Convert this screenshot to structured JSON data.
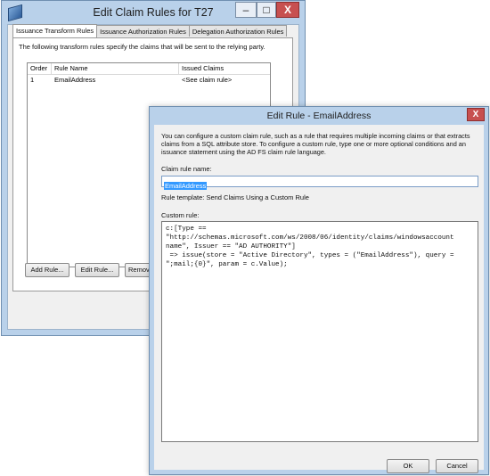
{
  "back_window": {
    "title": "Edit Claim Rules for T27",
    "controls": {
      "minimize": "–",
      "maximize": "□",
      "close": "X"
    },
    "tabs": [
      {
        "label": "Issuance Transform Rules",
        "active": true
      },
      {
        "label": "Issuance Authorization Rules",
        "active": false
      },
      {
        "label": "Delegation Authorization Rules",
        "active": false
      }
    ],
    "description": "The following transform rules specify the claims that will be sent to the relying party.",
    "table": {
      "headers": [
        "Order",
        "Rule Name",
        "Issued Claims"
      ],
      "rows": [
        [
          "1",
          "EmailAddress",
          "<See claim rule>"
        ]
      ]
    },
    "buttons": {
      "add": "Add Rule...",
      "edit": "Edit Rule...",
      "remove": "Remove"
    }
  },
  "front_window": {
    "title": "Edit Rule - EmailAddress",
    "close": "X",
    "description": "You can configure a custom claim rule, such as a rule that requires multiple incoming claims or that extracts claims from a SQL attribute store. To configure a custom rule, type one or more optional conditions and an issuance statement using the AD FS claim rule language.",
    "claim_rule_name_label": "Claim rule name:",
    "claim_rule_name_value": "EmailAddress",
    "rule_template": "Rule template: Send Claims Using a Custom Rule",
    "custom_rule_label": "Custom rule:",
    "custom_rule_text": "c:[Type ==\n\"http://schemas.microsoft.com/ws/2008/06/identity/claims/windowsaccount\nname\", Issuer == \"AD AUTHORITY\"]\n => issue(store = \"Active Directory\", types = (\"EmailAddress\"), query =\n\";mail;{0}\", param = c.Value);",
    "buttons": {
      "ok": "OK",
      "cancel": "Cancel"
    }
  },
  "colors": {
    "title_bar": "#b9d1ea",
    "close_button": "#c75050",
    "selection": "#3399ff"
  }
}
